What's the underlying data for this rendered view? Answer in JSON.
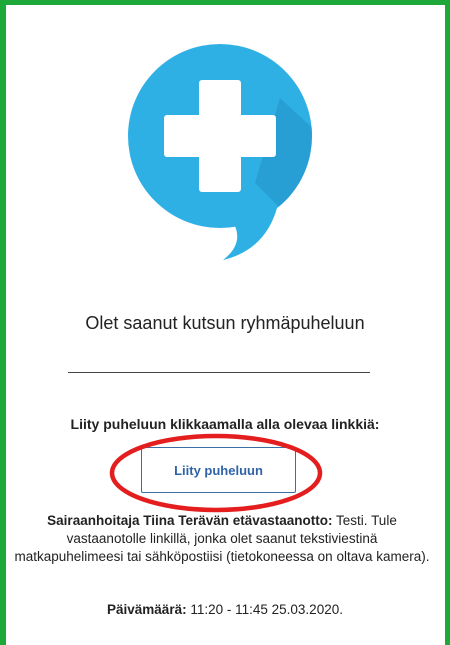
{
  "logo": {
    "icon": "medical-cross-chat-bubble-icon",
    "bubble_color": "#2fb0e5",
    "cross_color": "#ffffff"
  },
  "invite": {
    "title": "Olet saanut kutsun ryhmäpuheluun"
  },
  "instruction": "Liity puheluun klikkaamalla alla olevaa linkkiä:",
  "join_button": {
    "label": "Liity puheluun",
    "color": "#2f63a8"
  },
  "description": {
    "heading": "Sairaanhoitaja Tiina Terävän etävastaanotto:",
    "text": "Testi. Tule vastaanotolle linkillä, jonka olet saanut tekstiviestinä matkapuhelimeesi tai sähköpostiisi (tietokoneessa on oltava kamera)."
  },
  "date": {
    "label": "Päivämäärä:",
    "value": "11:20 - 11:45 25.03.2020."
  },
  "annotation": {
    "color": "#e41e1e",
    "frame_color": "#1fa83a"
  }
}
